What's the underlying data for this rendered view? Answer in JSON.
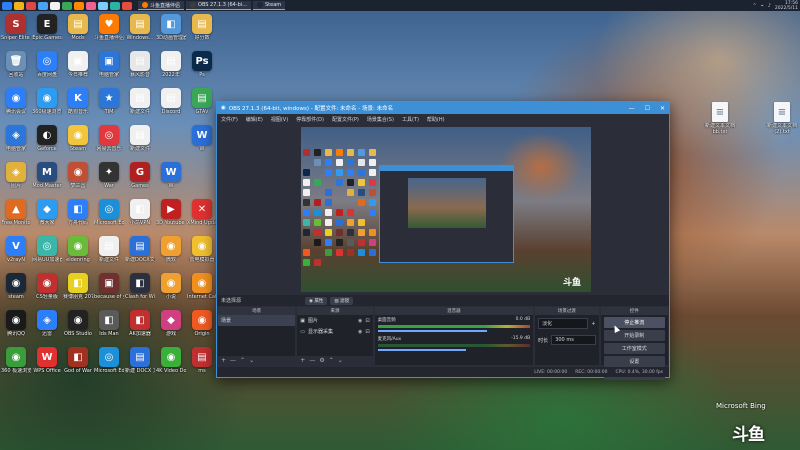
{
  "taskbar": {
    "icon_colors": [
      "#2d7ff9",
      "#f2b21b",
      "#e04848",
      "#4aa3f0",
      "#f2f2f2",
      "#3aa757",
      "#ff8a00",
      "#f06292",
      "#7ecbff",
      "#2bb3a6",
      "#e84c3d"
    ],
    "tasks": [
      {
        "label": "斗鱼直播伴侣",
        "color": "#ff7a00"
      },
      {
        "label": "OBS 27.1.3 (64-bi...",
        "color": "#3d3d3d"
      },
      {
        "label": "Steam",
        "color": "#1b2838"
      }
    ],
    "time": "17:56",
    "date": "2022/5/11"
  },
  "desktop_icons": [
    {
      "label": "Sniper Elite 4",
      "glyph": "S",
      "color": "#b03030"
    },
    {
      "label": "Epic Games",
      "glyph": "E",
      "color": "#222"
    },
    {
      "label": "Mods",
      "glyph": "▤",
      "color": "#e7b84b"
    },
    {
      "label": "斗鱼直播伴侣",
      "glyph": "♥",
      "color": "#ff7a00"
    },
    {
      "label": "Windows...",
      "glyph": "▤",
      "color": "#e7b84b"
    },
    {
      "label": "3D动画管理器",
      "glyph": "◧",
      "color": "#5599dd"
    },
    {
      "label": "好分数",
      "glyph": "▤",
      "color": "#e7b84b"
    },
    {
      "label": "",
      "glyph": "",
      "color": "transparent"
    },
    {
      "label": "回收站",
      "glyph": "🗑",
      "color": "#6b8fb5"
    },
    {
      "label": "百度网盘",
      "glyph": "◎",
      "color": "#2d7ff9"
    },
    {
      "label": "今日推荐",
      "glyph": "▣",
      "color": "#f0f0f0"
    },
    {
      "label": "电脑管家",
      "glyph": "▣",
      "color": "#2b76d8"
    },
    {
      "label": "暴风影音",
      "glyph": "▤",
      "color": "#e7e7e7"
    },
    {
      "label": "2022年",
      "glyph": "▤",
      "color": "#f0f0f0"
    },
    {
      "label": "Ps",
      "glyph": "Ps",
      "color": "#0b2a4a"
    },
    {
      "label": "",
      "glyph": "",
      "color": "transparent"
    },
    {
      "label": "腾讯会议",
      "glyph": "◉",
      "color": "#2d7ff9"
    },
    {
      "label": "360极速浏览器",
      "glyph": "◉",
      "color": "#2d9cf0"
    },
    {
      "label": "酷狗音乐",
      "glyph": "K",
      "color": "#2d7ff9"
    },
    {
      "label": "TIM",
      "glyph": "★",
      "color": "#2b76d8"
    },
    {
      "label": "新建文件",
      "glyph": "▤",
      "color": "#f0f0f0"
    },
    {
      "label": "Discord",
      "glyph": "▤",
      "color": "#f0f0f0"
    },
    {
      "label": "GTAV",
      "glyph": "▤",
      "color": "#3aa757"
    },
    {
      "label": "",
      "glyph": "",
      "color": "transparent"
    },
    {
      "label": "电脑管家",
      "glyph": "◈",
      "color": "#2b76d8"
    },
    {
      "label": "Geforce",
      "glyph": "◐",
      "color": "#222"
    },
    {
      "label": "Steam",
      "glyph": "◉",
      "color": "#f2c53d"
    },
    {
      "label": "网易云音乐",
      "glyph": "◎",
      "color": "#e0383e"
    },
    {
      "label": "新建文件",
      "glyph": "▤",
      "color": "#f0f0f0"
    },
    {
      "label": "",
      "glyph": "",
      "color": "transparent"
    },
    {
      "label": "W",
      "glyph": "W",
      "color": "#2b6fd8"
    },
    {
      "label": "",
      "glyph": "",
      "color": "transparent"
    },
    {
      "label": "图片",
      "glyph": "◈",
      "color": "#e0b13d"
    },
    {
      "label": "Mod Master",
      "glyph": "M",
      "color": "#2a4d80"
    },
    {
      "label": "梦三国",
      "glyph": "◉",
      "color": "#c14f36"
    },
    {
      "label": "War",
      "glyph": "✦",
      "color": "#333"
    },
    {
      "label": "Games",
      "glyph": "G",
      "color": "#b02020"
    },
    {
      "label": "W",
      "glyph": "W",
      "color": "#2b6fd8"
    },
    {
      "label": "",
      "glyph": "",
      "color": "transparent"
    },
    {
      "label": "",
      "glyph": "",
      "color": "transparent"
    },
    {
      "label": "Free Monito",
      "glyph": "▲",
      "color": "#e06a20"
    },
    {
      "label": "微大家",
      "glyph": "◆",
      "color": "#2d9cf0"
    },
    {
      "label": "方舟代码",
      "glyph": "◧",
      "color": "#2d7ff9"
    },
    {
      "label": "Microsoft Edge",
      "glyph": "◎",
      "color": "#1b8fd8"
    },
    {
      "label": "小鸟VPN",
      "glyph": "◧",
      "color": "#f0f0f0"
    },
    {
      "label": "3D Youtube Download",
      "glyph": "▶",
      "color": "#c02020"
    },
    {
      "label": "XMind Update",
      "glyph": "✕",
      "color": "#e03030"
    },
    {
      "label": "",
      "glyph": "",
      "color": "transparent"
    },
    {
      "label": "v2rayN",
      "glyph": "V",
      "color": "#2d7ff9"
    },
    {
      "label": "网易UU加速器",
      "glyph": "◎",
      "color": "#3ab7a8"
    },
    {
      "label": "eldenring",
      "glyph": "◉",
      "color": "#6bbb3a"
    },
    {
      "label": "新建文件",
      "glyph": "▤",
      "color": "#f0f0f0"
    },
    {
      "label": "新建DOCX文档",
      "glyph": "▤",
      "color": "#2b6fd8"
    },
    {
      "label": "微软",
      "glyph": "◉",
      "color": "#f0a030"
    },
    {
      "label": "雷电模拟器",
      "glyph": "◉",
      "color": "#f0c030"
    },
    {
      "label": "",
      "glyph": "",
      "color": "transparent"
    },
    {
      "label": "steam",
      "glyph": "◉",
      "color": "#1b2838"
    },
    {
      "label": "CS轻量版",
      "glyph": "◉",
      "color": "#c03030"
    },
    {
      "label": "赛博朋克 2077",
      "glyph": "◧",
      "color": "#e8d020"
    },
    {
      "label": "because of you.jpg",
      "glyph": "▣",
      "color": "#703030"
    },
    {
      "label": "Clash for Windows",
      "glyph": "◧",
      "color": "#2a3040"
    },
    {
      "label": "小说",
      "glyph": "◉",
      "color": "#f0a030"
    },
    {
      "label": "Internet Cafe Sim",
      "glyph": "◉",
      "color": "#f09020"
    },
    {
      "label": "",
      "glyph": "",
      "color": "transparent"
    },
    {
      "label": "腾讯QQ",
      "glyph": "◉",
      "color": "#1a1a1a"
    },
    {
      "label": "迅雷",
      "glyph": "◈",
      "color": "#2d7ff9"
    },
    {
      "label": "OBS Studio",
      "glyph": "◉",
      "color": "#222"
    },
    {
      "label": "Ids Man",
      "glyph": "◧",
      "color": "#5a5a5a"
    },
    {
      "label": "AK加速器",
      "glyph": "◧",
      "color": "#c03030"
    },
    {
      "label": "游戏",
      "glyph": "◆",
      "color": "#d04080"
    },
    {
      "label": "Origin",
      "glyph": "◉",
      "color": "#f05a22"
    },
    {
      "label": "",
      "glyph": "",
      "color": "transparent"
    },
    {
      "label": "360 极速浏览器",
      "glyph": "◉",
      "color": "#3a9c3a"
    },
    {
      "label": "WPS Office",
      "glyph": "W",
      "color": "#e03030"
    },
    {
      "label": "God of War",
      "glyph": "◧",
      "color": "#a03020"
    },
    {
      "label": "Microsoft Edge",
      "glyph": "◎",
      "color": "#1b8fd8"
    },
    {
      "label": "新建 DOCX 文档.docx",
      "glyph": "▤",
      "color": "#2b6fd8"
    },
    {
      "label": "4K Video Downloader",
      "glyph": "◉",
      "color": "#3ab03a"
    },
    {
      "label": "ms",
      "glyph": "▤",
      "color": "#c03030"
    },
    {
      "label": "",
      "glyph": "",
      "color": "transparent"
    }
  ],
  "right_icons": [
    {
      "label": "新建文本文档 bb.txt"
    },
    {
      "label": "新建文本文档 (2).txt"
    }
  ],
  "obs": {
    "title": "OBS 27.1.3 (64-bit, windows) - 配置文件: 未命名 - 场景: 未命名",
    "menu": [
      "文件(F)",
      "编辑(E)",
      "视图(V)",
      "停靠部件(D)",
      "配置文件(P)",
      "场景集合(S)",
      "工具(T)",
      "帮助(H)"
    ],
    "current_scene": "未选择源",
    "mid_buttons": [
      "◉ 属性",
      "▧ 滤镜"
    ],
    "docks": {
      "scenes": {
        "header": "场景",
        "items": [
          "场景"
        ]
      },
      "sources": {
        "header": "来源",
        "items": [
          "图片",
          "显示器采集"
        ]
      },
      "mixer": {
        "header": "混音器",
        "tracks": [
          {
            "name": "桌面音频",
            "value": "0.0 dB"
          },
          {
            "name": "麦克风/Aux",
            "value": "-15.9 dB"
          }
        ]
      },
      "transitions": {
        "header": "场景过渡",
        "type": "淡化",
        "duration_label": "时长",
        "duration": "300 ms"
      },
      "controls": {
        "header": "控件",
        "buttons": [
          "停止推流",
          "开始录制",
          "工作室模式",
          "设置",
          "退出"
        ]
      }
    },
    "status": {
      "live": "LIVE: 00:00:00",
      "rec": "REC: 00:00:00",
      "cpu": "CPU: 0.4%, 30.00 fps"
    }
  },
  "watermark": {
    "bing": "Microsoft Bing",
    "douyu": "斗鱼"
  }
}
